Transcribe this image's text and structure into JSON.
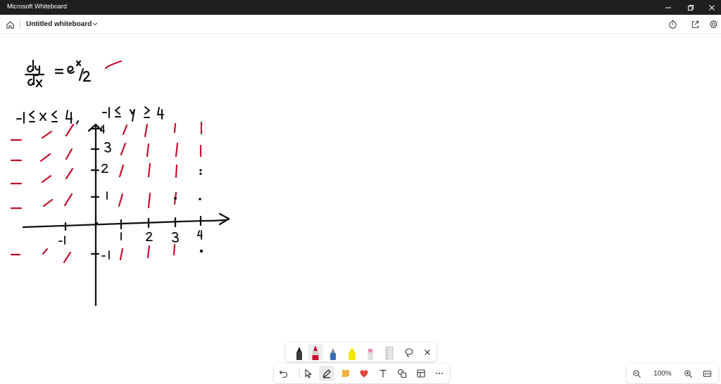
{
  "window": {
    "app_title": "Microsoft Whiteboard"
  },
  "toolbar": {
    "board_title": "Untitled whiteboard"
  },
  "canvas": {
    "ink_colors": {
      "black": "#111111",
      "red": "#c8102e"
    }
  },
  "pen_tray": {
    "pens": [
      {
        "name": "black-pen",
        "color": "#1a1a1a"
      },
      {
        "name": "red-pen",
        "color": "#c8102e",
        "selected": true
      },
      {
        "name": "blue-pen",
        "color": "#3b6fb5"
      },
      {
        "name": "yellow-highlighter",
        "color": "#f5e600"
      },
      {
        "name": "pink-highlighter",
        "color": "#f08ab0"
      },
      {
        "name": "ruler",
        "color": "#d0d0d0"
      }
    ]
  },
  "main_toolbar": {
    "active_tool": "pen",
    "accent_color": "#e3473c"
  },
  "zoom": {
    "level": "100%"
  }
}
